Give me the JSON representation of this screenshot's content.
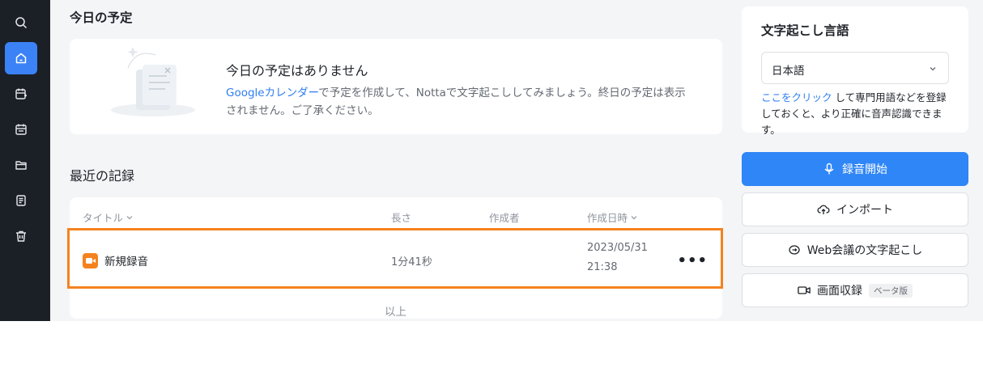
{
  "nav": {
    "items": [
      {
        "icon": "search-icon",
        "active": false
      },
      {
        "icon": "home-icon",
        "active": true
      },
      {
        "icon": "calendar-add-icon",
        "active": false
      },
      {
        "icon": "calendar-icon",
        "active": false
      },
      {
        "icon": "folder-icon",
        "active": false
      },
      {
        "icon": "document-icon",
        "active": false
      },
      {
        "icon": "trash-icon",
        "active": false
      }
    ]
  },
  "today": {
    "title": "今日の予定",
    "empty_title": "今日の予定はありません",
    "desc_link": "Googleカレンダー",
    "desc_text": "で予定を作成して、Nottaで文字起こししてみましょう。終日の予定は表示されません。ご了承ください。"
  },
  "recent": {
    "title": "最近の記録",
    "columns": {
      "title": "タイトル",
      "length": "長さ",
      "creator": "作成者",
      "created": "作成日時"
    },
    "rows": [
      {
        "title": "新規録音",
        "length": "1分41秒",
        "creator": "",
        "date": "2023/05/31",
        "time": "21:38"
      }
    ],
    "end_label": "以上"
  },
  "language": {
    "title": "文字起こし言語",
    "selected": "日本語",
    "note_link": "ここをクリック",
    "note_text": " して専門用語などを登録しておくと、より正確に音声認識できます。"
  },
  "actions": {
    "record": "録音開始",
    "import": "インポート",
    "web_meeting": "Web会議の文字起こし",
    "screen_record": "画面収録",
    "beta": "ベータ版"
  },
  "colors": {
    "accent": "#2f86f6",
    "highlight": "#f5821f",
    "sidebar": "#1b2027"
  }
}
